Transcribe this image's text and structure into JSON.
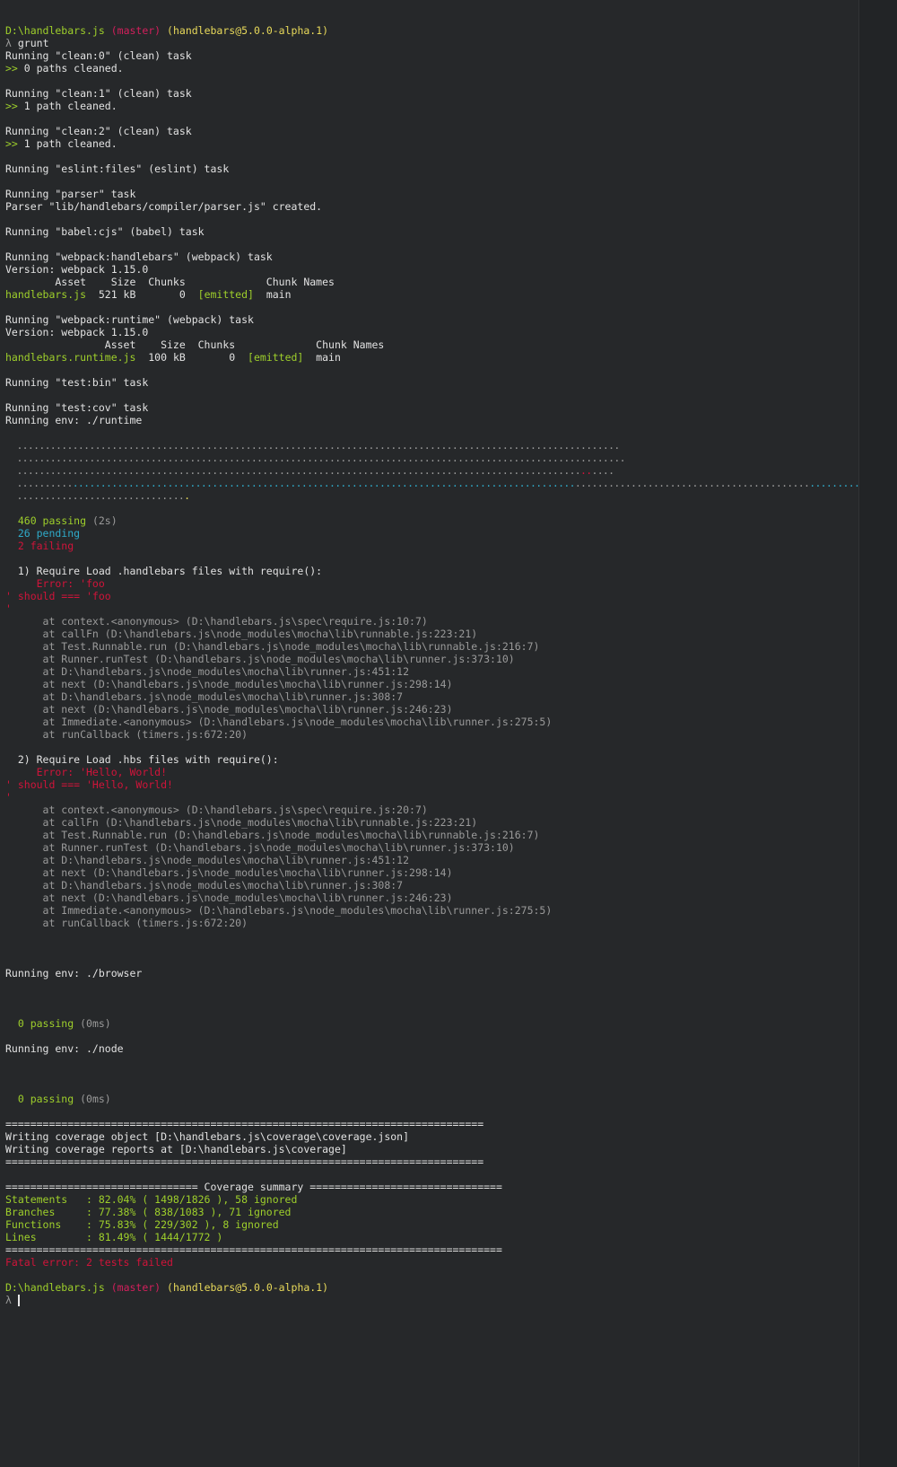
{
  "prompt": {
    "path": "D:\\handlebars.js",
    "branch": "(master)",
    "package": "(handlebars@5.0.0-alpha.1)",
    "lambda": "λ",
    "command": "grunt"
  },
  "tasks": {
    "clean0_header": "Running \"clean:0\" (clean) task",
    "clean0_result_prefix": ">>",
    "clean0_result": " 0 paths cleaned.",
    "clean1_header": "Running \"clean:1\" (clean) task",
    "clean1_result_prefix": ">>",
    "clean1_result": " 1 path cleaned.",
    "clean2_header": "Running \"clean:2\" (clean) task",
    "clean2_result_prefix": ">>",
    "clean2_result": " 1 path cleaned.",
    "eslint_header": "Running \"eslint:files\" (eslint) task",
    "parser_header": "Running \"parser\" task",
    "parser_result": "Parser \"lib/handlebars/compiler/parser.js\" created.",
    "babel_header": "Running \"babel:cjs\" (babel) task",
    "webpack_hb_header": "Running \"webpack:handlebars\" (webpack) task",
    "webpack_hb_version": "Version: webpack 1.15.0",
    "webpack_hb_cols": "        Asset    Size  Chunks             Chunk Names",
    "webpack_hb_asset": "handlebars.js",
    "webpack_hb_size": "  521 kB       0",
    "webpack_hb_emitted": "  [emitted]",
    "webpack_hb_name": "  main",
    "webpack_rt_header": "Running \"webpack:runtime\" (webpack) task",
    "webpack_rt_version": "Version: webpack 1.15.0",
    "webpack_rt_cols": "                Asset    Size  Chunks             Chunk Names",
    "webpack_rt_asset": "handlebars.runtime.js",
    "webpack_rt_size": "  100 kB       0",
    "webpack_rt_emitted": "  [emitted]",
    "webpack_rt_name": "  main",
    "testbin_header": "Running \"test:bin\" task",
    "testcov_header": "Running \"test:cov\" task",
    "runtime_env": "Running env: ./runtime"
  },
  "mocha": {
    "dots_1": "  ............................................................................................................",
    "dots_2": "  .............................................................................................................",
    "dots_3a": "  .....................................................................................................",
    "dots_3b": "..",
    "dots_3c": "....",
    "dots_4a": "  ..........",
    "dots_4b": "..........................................................................................",
    "dots_4c": "..........................................",
    "dots_4d": "...........",
    "dots_4e": "..................",
    "dots_5a": "  ..............................",
    "dots_5b": ".",
    "passing": "  460 passing",
    "passing_time": " (2s)",
    "pending": "  26 pending",
    "failing": "  2 failing"
  },
  "failures": [
    {
      "title": "  1) Require Load .handlebars files with require():",
      "error_1": "     Error: 'foo",
      "error_2": "' should === 'foo",
      "error_3": "'",
      "stack": [
        "      at context.<anonymous> (D:\\handlebars.js\\spec\\require.js:10:7)",
        "      at callFn (D:\\handlebars.js\\node_modules\\mocha\\lib\\runnable.js:223:21)",
        "      at Test.Runnable.run (D:\\handlebars.js\\node_modules\\mocha\\lib\\runnable.js:216:7)",
        "      at Runner.runTest (D:\\handlebars.js\\node_modules\\mocha\\lib\\runner.js:373:10)",
        "      at D:\\handlebars.js\\node_modules\\mocha\\lib\\runner.js:451:12",
        "      at next (D:\\handlebars.js\\node_modules\\mocha\\lib\\runner.js:298:14)",
        "      at D:\\handlebars.js\\node_modules\\mocha\\lib\\runner.js:308:7",
        "      at next (D:\\handlebars.js\\node_modules\\mocha\\lib\\runner.js:246:23)",
        "      at Immediate.<anonymous> (D:\\handlebars.js\\node_modules\\mocha\\lib\\runner.js:275:5)",
        "      at runCallback (timers.js:672:20)"
      ]
    },
    {
      "title": "  2) Require Load .hbs files with require():",
      "error_1": "     Error: 'Hello, World!",
      "error_2": "' should === 'Hello, World!",
      "error_3": "'",
      "stack": [
        "      at context.<anonymous> (D:\\handlebars.js\\spec\\require.js:20:7)",
        "      at callFn (D:\\handlebars.js\\node_modules\\mocha\\lib\\runnable.js:223:21)",
        "      at Test.Runnable.run (D:\\handlebars.js\\node_modules\\mocha\\lib\\runnable.js:216:7)",
        "      at Runner.runTest (D:\\handlebars.js\\node_modules\\mocha\\lib\\runner.js:373:10)",
        "      at D:\\handlebars.js\\node_modules\\mocha\\lib\\runner.js:451:12",
        "      at next (D:\\handlebars.js\\node_modules\\mocha\\lib\\runner.js:298:14)",
        "      at D:\\handlebars.js\\node_modules\\mocha\\lib\\runner.js:308:7",
        "      at next (D:\\handlebars.js\\node_modules\\mocha\\lib\\runner.js:246:23)",
        "      at Immediate.<anonymous> (D:\\handlebars.js\\node_modules\\mocha\\lib\\runner.js:275:5)",
        "      at runCallback (timers.js:672:20)"
      ]
    }
  ],
  "envs": {
    "browser_env": "Running env: ./browser",
    "browser_passing": "  0 passing",
    "browser_time": " (0ms)",
    "node_env": "Running env: ./node",
    "node_passing": "  0 passing",
    "node_time": " (0ms)"
  },
  "coverage": {
    "rule_1": "=============================================================================",
    "write_object": "Writing coverage object [D:\\handlebars.js\\coverage\\coverage.json]",
    "write_reports": "Writing coverage reports at [D:\\handlebars.js\\coverage]",
    "rule_2": "=============================================================================",
    "summary_header": "=============================== Coverage summary ===============================",
    "statements": "Statements   : 82.04% ( 1498/1826 ), 58 ignored",
    "branches": "Branches     : 77.38% ( 838/1083 ), 71 ignored",
    "functions": "Functions    : 75.83% ( 229/302 ), 8 ignored",
    "lines": "Lines        : 81.49% ( 1444/1772 )",
    "rule_3": "================================================================================",
    "fatal": "Fatal error: 2 tests failed"
  },
  "colors": {
    "background": "#26282a",
    "green": "#9ecf2b",
    "red": "#d0143a",
    "cyan": "#2faac9",
    "gray": "#9a9a9a"
  }
}
